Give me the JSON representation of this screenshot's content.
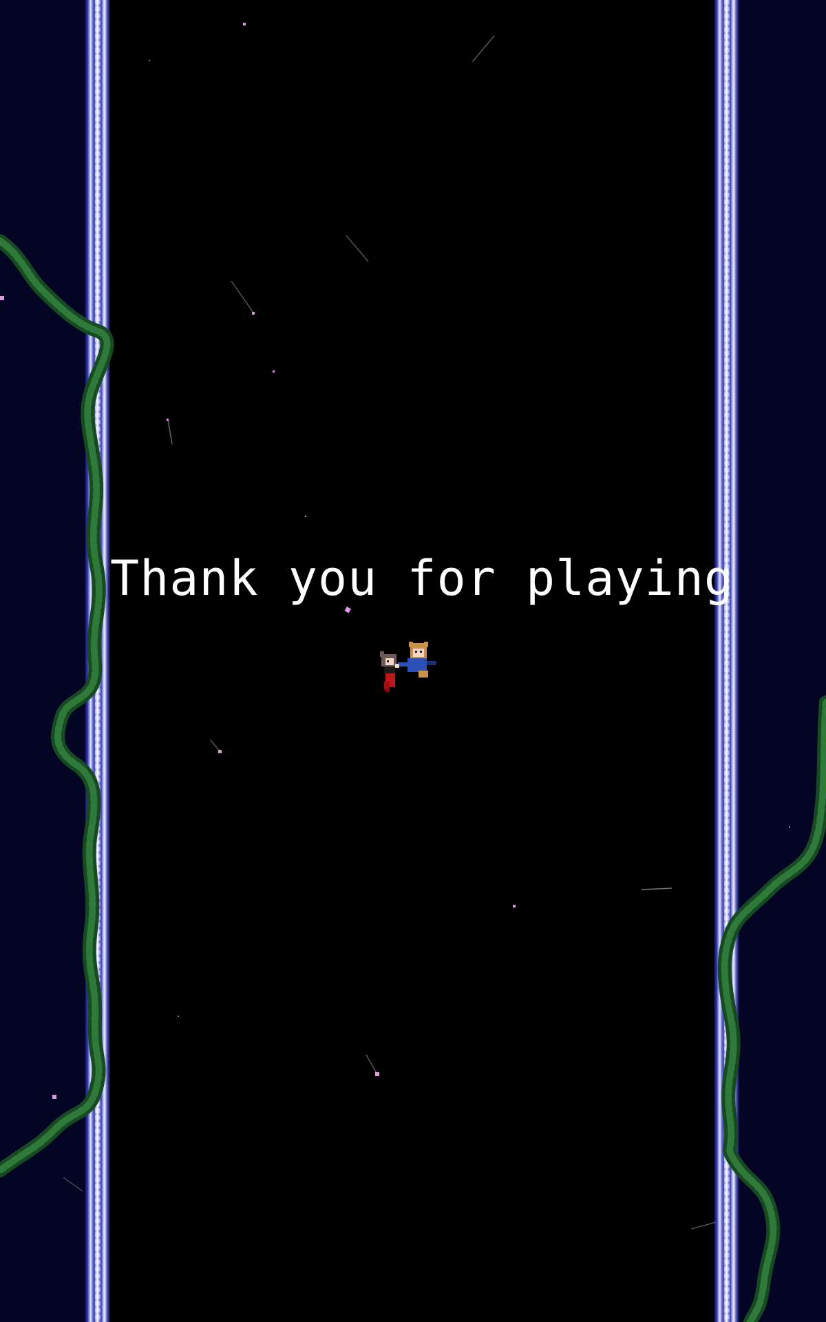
{
  "screen": {
    "message": "Thank you for playing"
  },
  "colors": {
    "background": "#000000",
    "side_panel": "#050628",
    "rail_light": "#e8eaff",
    "rail_dark": "#2b2f9a",
    "vine": "#2f7a3a",
    "vine_dark": "#184a22",
    "sparkle": "#d99be0",
    "text": "#ffffff"
  },
  "sprites": [
    {
      "name": "girl-red-dress",
      "icon": "red-dress-character-icon"
    },
    {
      "name": "boy-blue-outfit",
      "icon": "blue-outfit-character-icon"
    }
  ]
}
